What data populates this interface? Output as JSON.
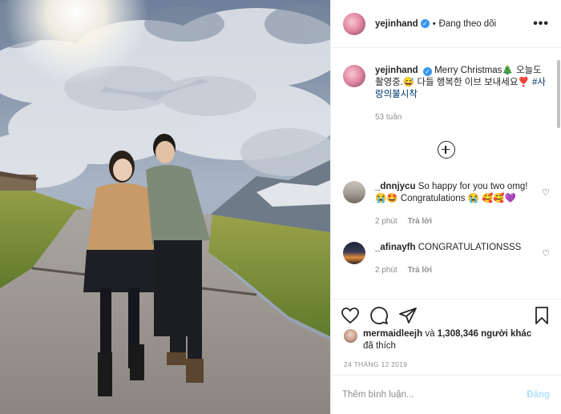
{
  "post": {
    "username": "yejinhand",
    "follow_status": "Đang theo dõi",
    "more_label": "•••",
    "caption_text": "Merry Christmas🎄 오늘도 촬영중.😅 다들 행복한 이브 보내세요❣️",
    "hashtag": "#사랑의불시착",
    "caption_time": "53 tuần",
    "colors": {
      "accent": "#3897f0",
      "text": "#262626",
      "muted": "#8e8e8e",
      "post_disabled": "#b2dffc"
    }
  },
  "comments": [
    {
      "username": "_dnnjycu",
      "text": "So happy for you two omg! 😭🤩 Congratulations 😭 🥰🥰💜",
      "time": "2 phút",
      "reply": "Trả lời"
    },
    {
      "username": "_afinayfh",
      "text": "CONGRATULATIONSSS",
      "time": "2 phút",
      "reply": "Trả lời"
    }
  ],
  "likes": {
    "username": "mermaidleejh",
    "connector": "và",
    "count": "1,308,346 người khác",
    "suffix": "đã thích"
  },
  "date": "24 THÁNG 12 2019",
  "add_comment": {
    "placeholder": "Thêm bình luận...",
    "post_label": "Đăng"
  },
  "icons": [
    "heart-icon",
    "comment-icon",
    "share-icon",
    "bookmark-icon",
    "plus-circle-icon",
    "verified-icon"
  ]
}
